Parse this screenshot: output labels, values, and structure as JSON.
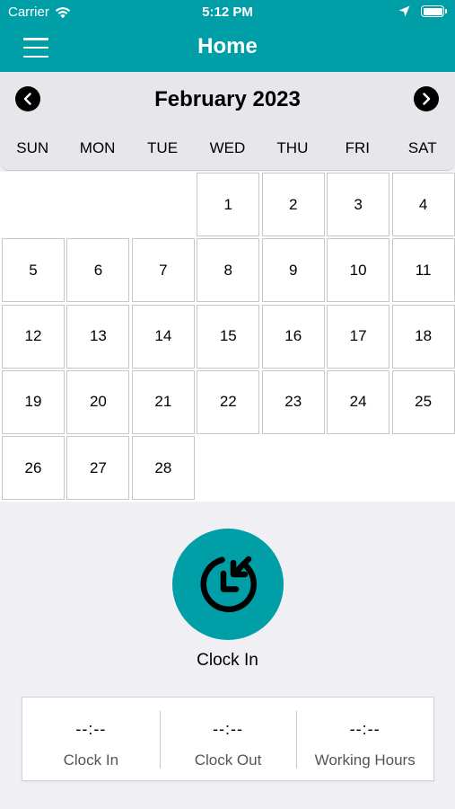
{
  "status_bar": {
    "carrier": "Carrier",
    "time": "5:12 PM"
  },
  "nav": {
    "title": "Home",
    "menu_icon": "hamburger-menu-icon"
  },
  "calendar": {
    "month_label": "February 2023",
    "prev_icon": "chevron-left-icon",
    "next_icon": "chevron-right-icon",
    "weekdays": [
      "SUN",
      "MON",
      "TUE",
      "WED",
      "THU",
      "FRI",
      "SAT"
    ],
    "days": [
      "1",
      "2",
      "3",
      "4",
      "5",
      "6",
      "7",
      "8",
      "9",
      "10",
      "11",
      "12",
      "13",
      "14",
      "15",
      "16",
      "17",
      "18",
      "19",
      "20",
      "21",
      "22",
      "23",
      "24",
      "25",
      "26",
      "27",
      "28"
    ]
  },
  "clock": {
    "button_icon": "clock-in-icon",
    "label": "Clock In"
  },
  "summary": [
    {
      "value": "--:--",
      "label": "Clock In"
    },
    {
      "value": "--:--",
      "label": "Clock Out"
    },
    {
      "value": "--:--",
      "label": "Working Hours"
    }
  ],
  "colors": {
    "accent": "#009fa8",
    "background": "#efeff4",
    "calendar_header": "#e6e6eb"
  }
}
